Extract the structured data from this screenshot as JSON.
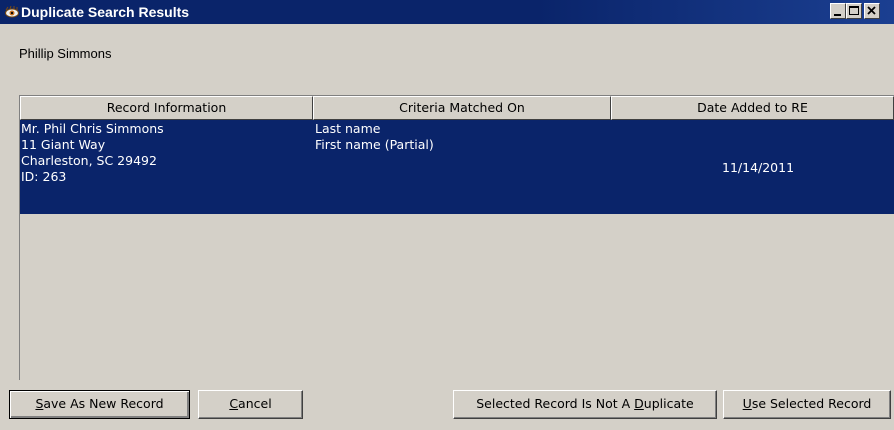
{
  "window": {
    "title": "Duplicate Search Results"
  },
  "subtitle": "Phillip Simmons",
  "table": {
    "columns": [
      "Record Information",
      "Criteria Matched On",
      "Date Added to RE"
    ],
    "rows": [
      {
        "record_lines": [
          "Mr. Phil Chris Simmons",
          "11 Giant Way",
          "Charleston, SC  29492",
          "ID: 263"
        ],
        "criteria_lines": [
          "Last name",
          "First name (Partial)"
        ],
        "date_added": "11/14/2011",
        "selected": true
      }
    ]
  },
  "buttons": {
    "save_new": {
      "prefix": "",
      "mnemonic": "S",
      "suffix": "ave As New Record"
    },
    "cancel": {
      "prefix": "",
      "mnemonic": "C",
      "suffix": "ancel"
    },
    "not_duplicate": {
      "prefix": "Selected Record Is Not A ",
      "mnemonic": "D",
      "suffix": "uplicate"
    },
    "use_selected": {
      "prefix": "",
      "mnemonic": "U",
      "suffix": "se Selected Record"
    }
  },
  "colors": {
    "titlebar": "#0a246a",
    "selection": "#0a246a",
    "face": "#d4d0c8"
  },
  "icons": {
    "app": "eye-icon",
    "minimize": "minimize-icon",
    "maximize": "maximize-icon",
    "close": "close-icon"
  }
}
